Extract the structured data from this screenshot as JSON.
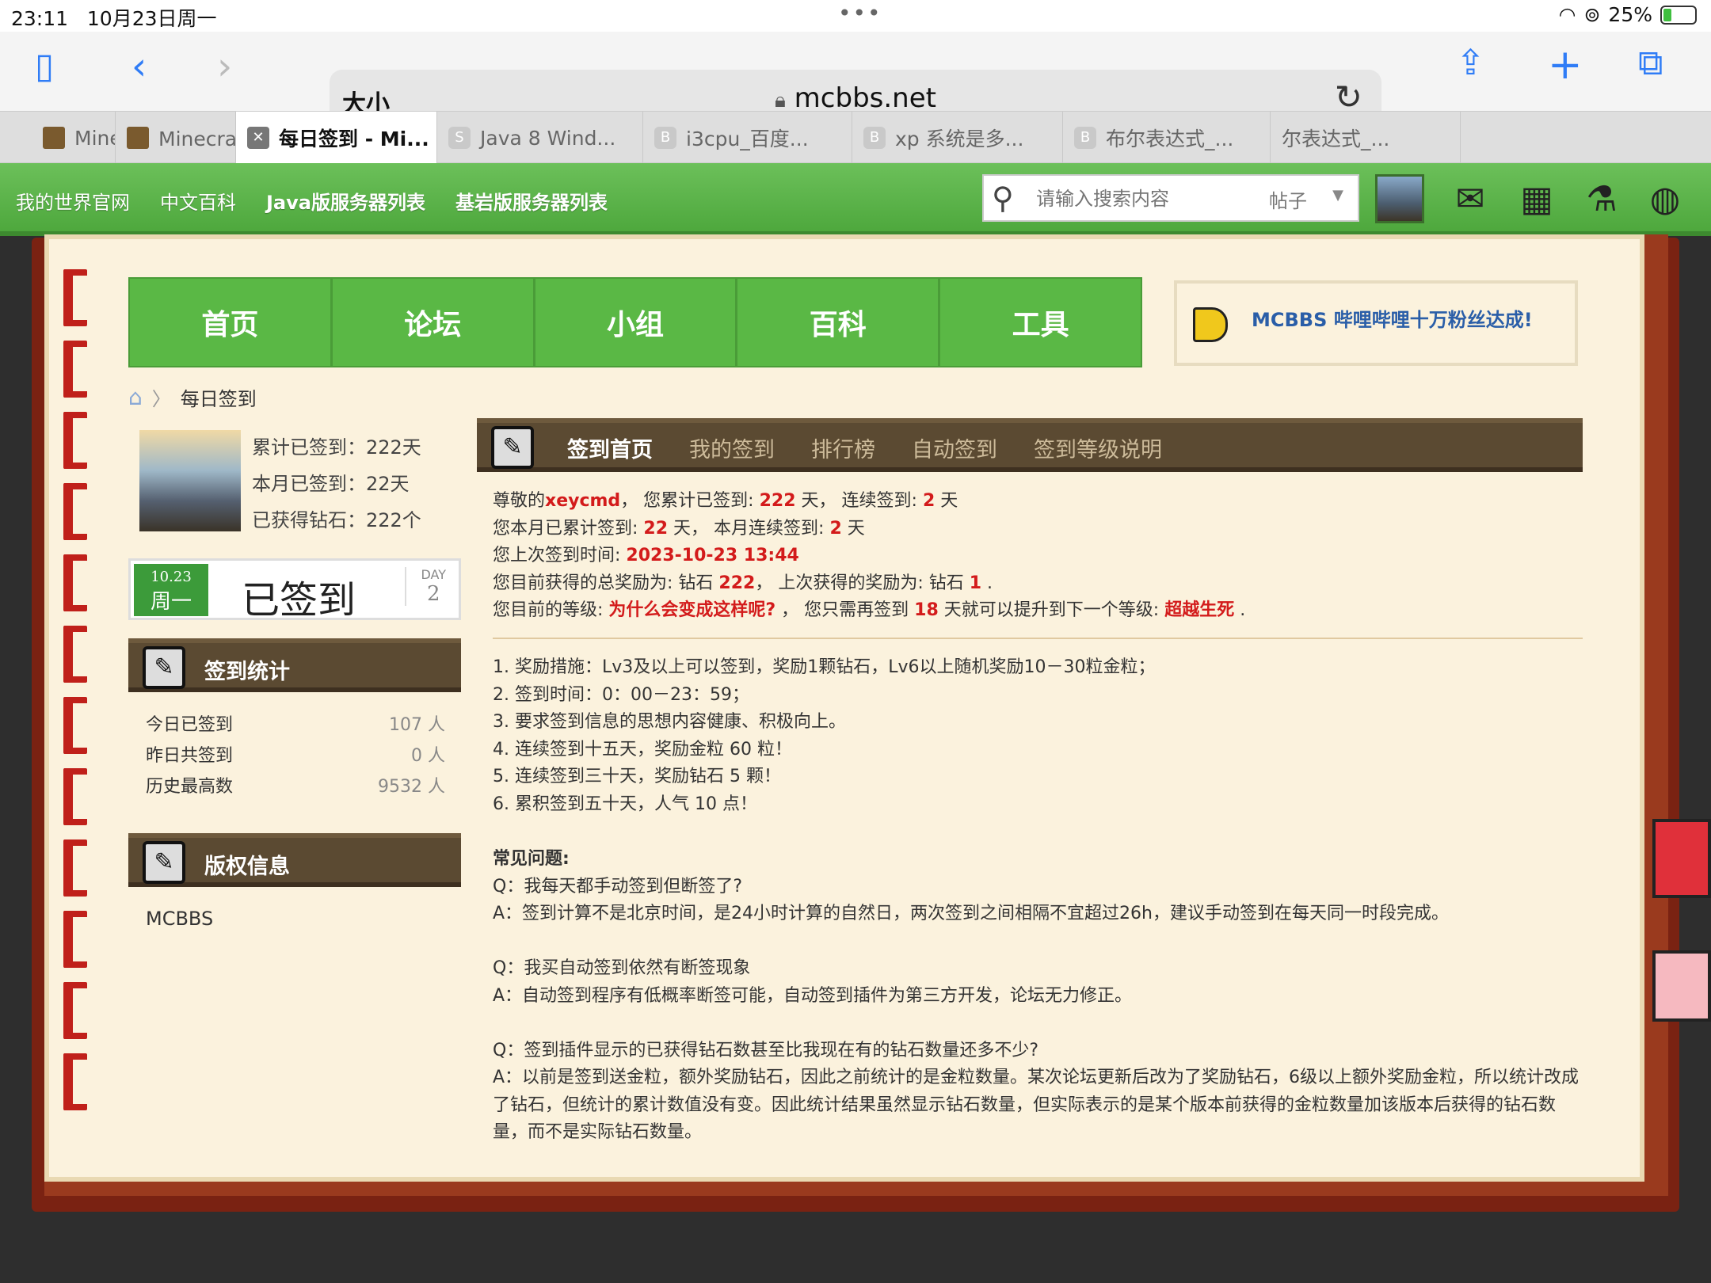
{
  "status": {
    "time": "23:11",
    "date": "10月23日周一",
    "battery": "25%",
    "battery_level": 0.25
  },
  "browser": {
    "address_size": "大小",
    "url": "mcbbs.net",
    "tabs": [
      {
        "label": "Minecra",
        "favicon": "mc"
      },
      {
        "label": "Minecraft(我...",
        "favicon": "mc"
      },
      {
        "label": "每日签到 - Mi...",
        "favicon": "close",
        "active": true
      },
      {
        "label": "Java 8 Wind...",
        "favicon": "S"
      },
      {
        "label": "i3cpu_百度...",
        "favicon": "B"
      },
      {
        "label": "xp 系统是多...",
        "favicon": "B"
      },
      {
        "label": "布尔表达式_...",
        "favicon": "B"
      },
      {
        "label": "尔表达式_...",
        "favicon": ""
      }
    ]
  },
  "site": {
    "links": [
      "我的世界官网",
      "中文百科",
      "Java版服务器列表",
      "基岩版服务器列表"
    ],
    "search_placeholder": "请输入搜索内容",
    "search_scope": "帖子",
    "nav": [
      "首页",
      "论坛",
      "小组",
      "百科",
      "工具"
    ],
    "notice": "MCBBS 哔哩哔哩十万粉丝达成!",
    "breadcrumb": "每日签到"
  },
  "user": {
    "total": "累计已签到：222天",
    "month": "本月已签到：22天",
    "diamonds": "已获得钻石：222个",
    "card_date": "10.23",
    "card_weekday": "周一",
    "card_status": "已签到",
    "day_label": "DAY",
    "day_value": "2"
  },
  "stats": {
    "title": "签到统计",
    "rows": [
      {
        "label": "今日已签到",
        "value": "107 人"
      },
      {
        "label": "昨日共签到",
        "value": "0 人"
      },
      {
        "label": "历史最高数",
        "value": "9532 人"
      }
    ]
  },
  "copyright": {
    "title": "版权信息",
    "text": "MCBBS"
  },
  "main": {
    "tabs": [
      "签到首页",
      "我的签到",
      "排行榜",
      "自动签到",
      "签到等级说明"
    ],
    "info": {
      "l1a": "尊敬的",
      "username": "xeycmd",
      "l1b": "， 您累计已签到: ",
      "total": "222",
      "l1c": " 天， 连续签到: ",
      "streak": "2",
      "l1d": " 天",
      "l2a": "您本月已累计签到: ",
      "month": "22",
      "l2b": " 天， 本月连续签到: ",
      "month_streak": "2",
      "l2c": " 天",
      "l3a": "您上次签到时间: ",
      "last_time": "2023-10-23 13:44",
      "l4a": "您目前获得的总奖励为: 钻石 ",
      "reward_total": "222",
      "l4b": "， 上次获得的奖励为: 钻石 ",
      "reward_last": "1",
      "l4c": " .",
      "l5a": "您目前的等级: ",
      "level": "为什么会变成这样呢?",
      "l5b": " ， 您只需再签到 ",
      "need": "18",
      "l5c": " 天就可以提升到下一个等级: ",
      "next_level": "超越生死",
      "l5d": " ."
    },
    "rules": [
      "1.  奖励措施：Lv3及以上可以签到，奖励1颗钻石，Lv6以上随机奖励10－30粒金粒；",
      "2.  签到时间：0：00－23：59；",
      "3.  要求签到信息的思想内容健康、积极向上。",
      "4.  连续签到十五天，奖励金粒 60 粒！",
      "5.  连续签到三十天，奖励钻石 5 颗！",
      "6.  累积签到五十天，人气 10 点！"
    ],
    "faq_title": "常见问题:",
    "faq": [
      {
        "q": "Q：我每天都手动签到但断签了?",
        "a": "A：签到计算不是北京时间，是24小时计算的自然日，两次签到之间相隔不宜超过26h，建议手动签到在每天同一时段完成。"
      },
      {
        "q": "Q：我买自动签到依然有断签现象",
        "a": "A：自动签到程序有低概率断签可能，自动签到插件为第三方开发，论坛无力修正。"
      },
      {
        "q": "Q：签到插件显示的已获得钻石数甚至比我现在有的钻石数量还多不少?",
        "a": "A：以前是签到送金粒，额外奖励钻石，因此之前统计的是金粒数量。某次论坛更新后改为了奖励钻石，6级以上额外奖励金粒，所以统计改成了钻石，但统计的累计数值没有变。因此统计结果虽然显示钻石数量，但实际表示的是某个版本前获得的金粒数量加该版本后获得的钻石数量，而不是实际钻石数量。"
      }
    ]
  },
  "colors": {
    "green": "#5ab845",
    "brown": "#5b4a32",
    "red": "#d31b1b",
    "link_blue": "#2a5ea8",
    "ios_blue": "#2f7cf6"
  },
  "icons": [
    "sidebar-icon",
    "back-icon",
    "forward-icon",
    "lock-icon",
    "reload-icon",
    "share-icon",
    "plus-icon",
    "tabs-icon",
    "search-icon",
    "home-icon",
    "speaker-icon"
  ]
}
